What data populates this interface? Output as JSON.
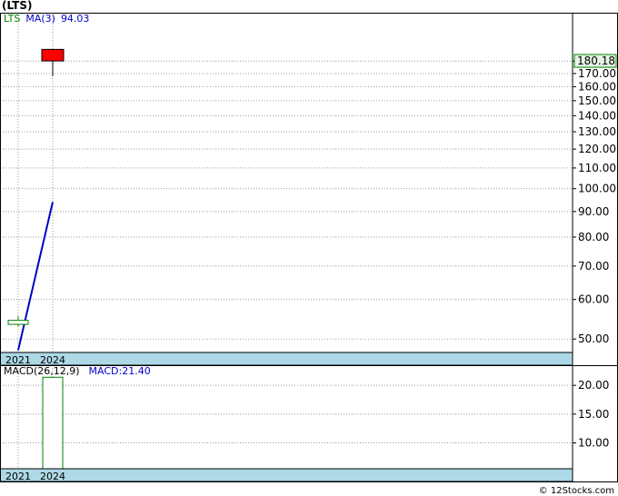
{
  "title": "(LTS)",
  "copyright": "© 12Stocks.com",
  "colors": {
    "up": "#008000",
    "down": "#ff0000",
    "ma": "#0000cc",
    "macd_label": "#0000cc",
    "band": "#add8e6",
    "grid": "#9a9a9a",
    "last_price_border": "#008000",
    "last_price_bg": "#e6f5e6"
  },
  "chart_data": [
    {
      "type": "candlestick",
      "legend": {
        "symbol": "LTS",
        "ma_label": "MA(3)",
        "ma_value": "94.03"
      },
      "last_price": "180.18",
      "y_ticks": [
        "50.00",
        "60.00",
        "70.00",
        "80.00",
        "90.00",
        "100.00",
        "110.00",
        "120.00",
        "130.00",
        "140.00",
        "150.00",
        "160.00",
        "170.00",
        "180.00"
      ],
      "x_ticks": [
        "2021",
        "2024"
      ],
      "scale": "log",
      "ylim": [
        47,
        225
      ],
      "grid": true,
      "candles": [
        {
          "x": "2021",
          "open": 53.5,
          "close": 54.5,
          "high": 55.5,
          "low": 53.0,
          "direction": "up"
        },
        {
          "x": "2024",
          "open": 190.0,
          "close": 180.18,
          "high": 190.0,
          "low": 168.0,
          "direction": "down"
        }
      ],
      "ma_series": {
        "name": "MA(3)",
        "points": [
          {
            "x": "2021",
            "y": 47.5
          },
          {
            "x": "2024",
            "y": 94.03
          }
        ]
      }
    },
    {
      "type": "bar",
      "legend": {
        "label": "MACD(26,12,9)",
        "value_label": "MACD:21.40"
      },
      "y_ticks": [
        "10.00",
        "15.00",
        "20.00"
      ],
      "x_ticks": [
        "2021",
        "2024"
      ],
      "ylim": [
        5.5,
        23.5
      ],
      "grid": true,
      "bars": [
        {
          "x": "2024",
          "value": 21.4
        }
      ]
    }
  ]
}
